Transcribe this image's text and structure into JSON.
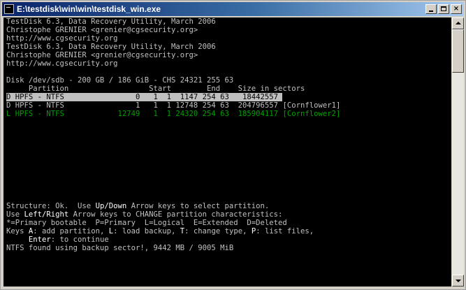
{
  "window": {
    "title": "E:\\testdisk\\win\\win\\testdisk_win.exe",
    "minimize_icon": "minimize-icon",
    "maximize_icon": "maximize-icon",
    "close_label": "×"
  },
  "console": {
    "header": [
      "TestDisk 6.3, Data Recovery Utility, March 2006",
      "Christophe GRENIER <grenier@cgsecurity.org>",
      "http://www.cgsecurity.org",
      "TestDisk 6.3, Data Recovery Utility, March 2006",
      "Christophe GRENIER <grenier@cgsecurity.org>",
      "http://www.cgsecurity.org"
    ],
    "disk_info": "Disk /dev/sdb - 200 GB / 186 GiB - CHS 24321 255 63",
    "table_header": "     Partition                  Start        End    Size in sectors",
    "partitions": [
      {
        "row": "D HPFS - NTFS                0   1  1  1147 254 63   18442557 ",
        "name": ""
      },
      {
        "row": "D HPFS - NTFS                1   1  1 12748 254 63  204796557 ",
        "name": "[Cornflower1]"
      },
      {
        "row": "L HPFS - NTFS            12749   1  1 24320 254 63  185904117 ",
        "name": "[Cornflower2]"
      }
    ],
    "status_line": {
      "prefix": "Structure: Ok.  Use ",
      "key": "Up/Down",
      "suffix": " Arrow keys to select partition."
    },
    "use_line": {
      "prefix": "Use ",
      "key": "Left/Right",
      "suffix": " Arrow keys to CHANGE partition characteristics:"
    },
    "legend": "*=Primary bootable  P=Primary  L=Logical  E=Extended  D=Deleted",
    "keys_line": {
      "prefix": "Keys ",
      "k1": "A",
      "t1": ": add partition, ",
      "k2": "L",
      "t2": ": load backup, ",
      "k3": "T",
      "t3": ": change type, ",
      "k4": "P",
      "t4": ": list files,"
    },
    "enter_line": {
      "prefix": "     ",
      "key": "Enter",
      "suffix": ": to continue"
    },
    "ntfs_line": "NTFS found using backup sector!, 9442 MB / 9005 MiB"
  },
  "scrollbar": {
    "up_icon": "arrow-up-icon",
    "down_icon": "arrow-down-icon"
  }
}
